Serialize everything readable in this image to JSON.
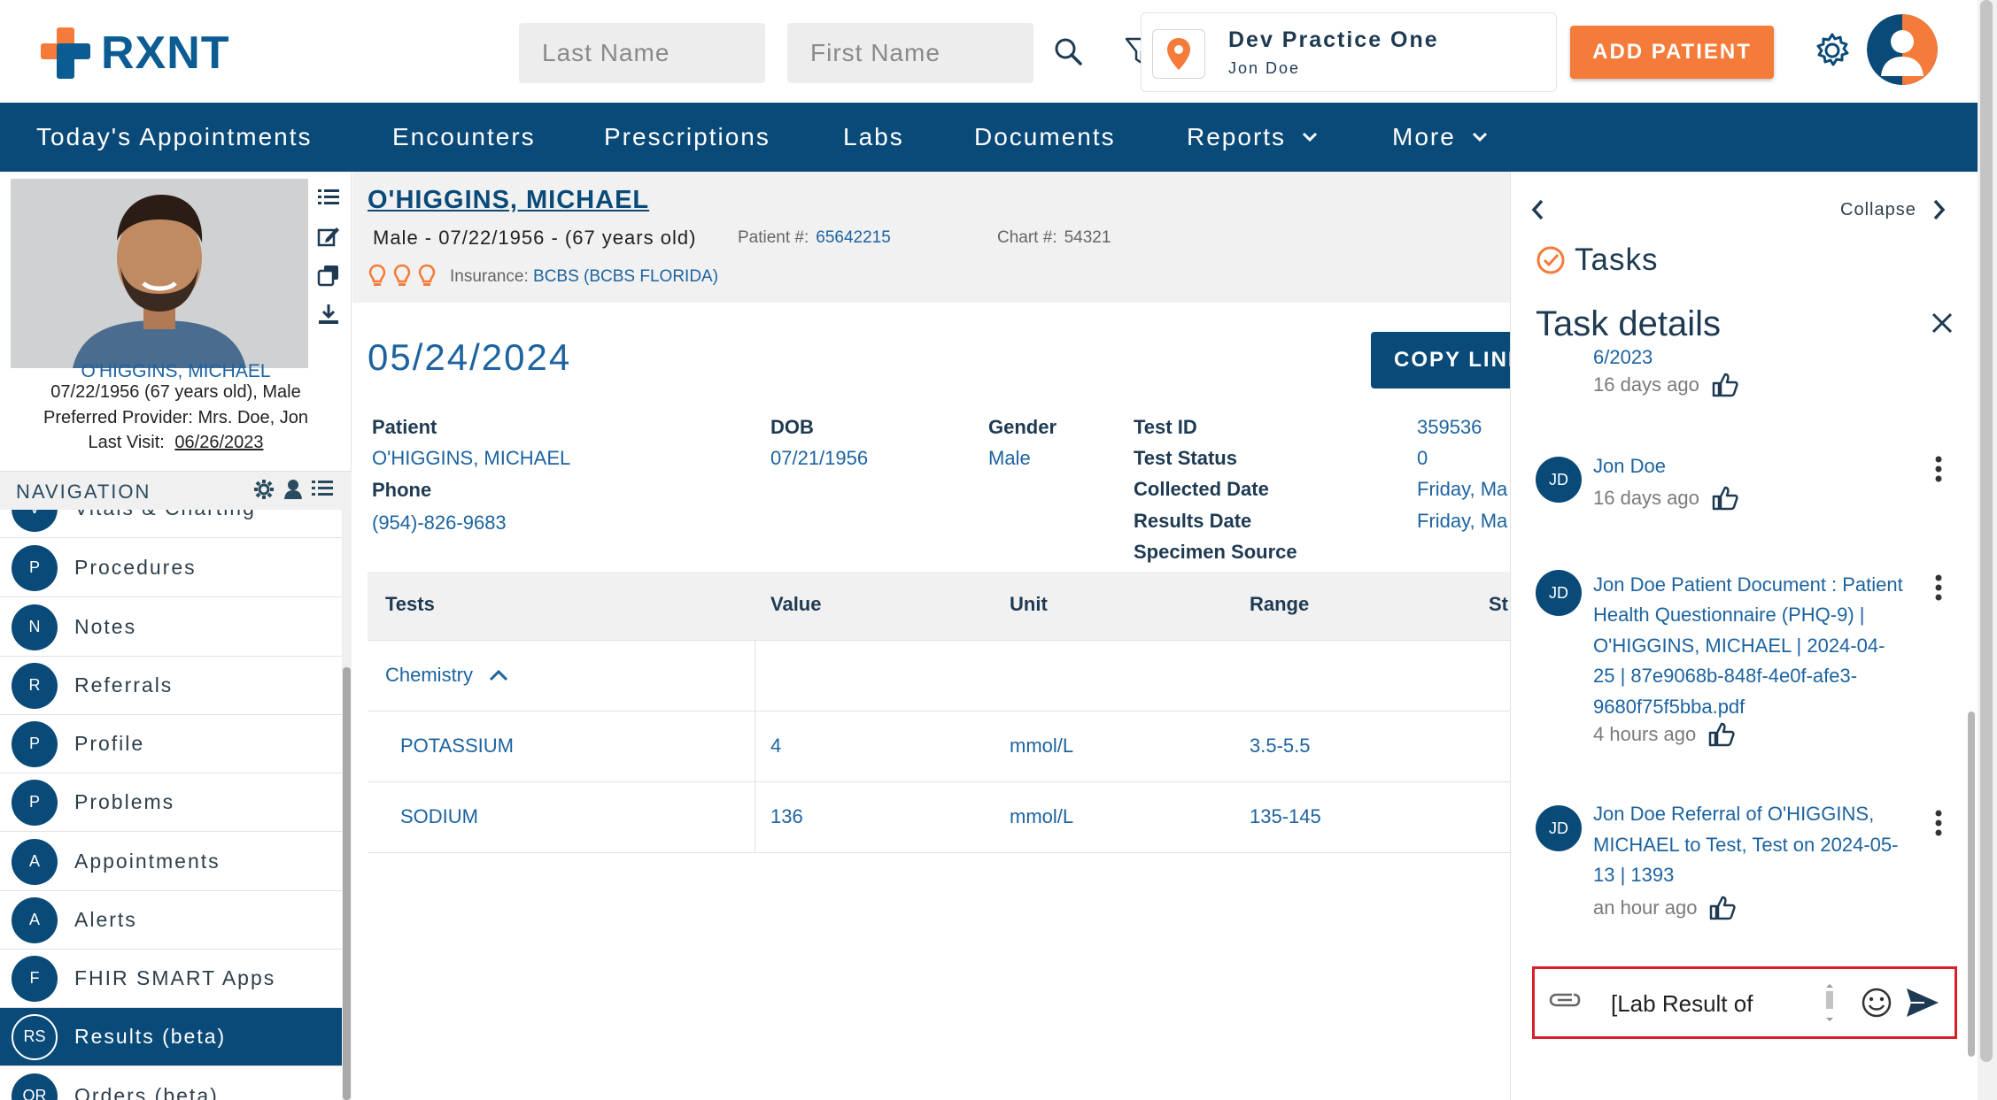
{
  "header": {
    "logo_text": "RXNT",
    "last_name_placeholder": "Last Name",
    "first_name_placeholder": "First Name",
    "practice_name": "Dev Practice One",
    "practice_user": "Jon Doe",
    "add_patient_label": "ADD PATIENT",
    "brand_color": "#0a5c93",
    "accent_color": "#f47b39"
  },
  "nav": {
    "items": [
      {
        "label": "Today's Appointments"
      },
      {
        "label": "Encounters"
      },
      {
        "label": "Prescriptions"
      },
      {
        "label": "Labs"
      },
      {
        "label": "Documents"
      },
      {
        "label": "Reports"
      },
      {
        "label": "More"
      }
    ]
  },
  "patient_card": {
    "name": "O'HIGGINS, MICHAEL",
    "dob_line": "07/22/1956 (67 years old), Male",
    "provider_line": "Preferred Provider: Mrs. Doe, Jon",
    "last_visit_label": "Last Visit:",
    "last_visit": "06/26/2023"
  },
  "navigation": {
    "title": "NAVIGATION",
    "items": [
      {
        "initial": "V",
        "label": "Vitals & Charting"
      },
      {
        "initial": "P",
        "label": "Procedures"
      },
      {
        "initial": "N",
        "label": "Notes"
      },
      {
        "initial": "R",
        "label": "Referrals"
      },
      {
        "initial": "P",
        "label": "Profile"
      },
      {
        "initial": "P",
        "label": "Problems"
      },
      {
        "initial": "A",
        "label": "Appointments"
      },
      {
        "initial": "A",
        "label": "Alerts"
      },
      {
        "initial": "F",
        "label": "FHIR SMART Apps"
      },
      {
        "initial": "RS",
        "label": "Results (beta)"
      },
      {
        "initial": "OR",
        "label": "Orders (beta)"
      }
    ]
  },
  "patient_header": {
    "title": "O'HIGGINS, MICHAEL",
    "subtitle": "Male - 07/22/1956 - (67 years old)",
    "patient_num_label": "Patient #:",
    "patient_num": "65642215",
    "chart_num_label": "Chart #:",
    "chart_num": "54321",
    "insurance_label": "Insurance:",
    "insurance": "BCBS (BCBS FLORIDA)"
  },
  "result": {
    "date": "05/24/2024",
    "copy_link_label": "COPY LINK",
    "patient_label": "Patient",
    "patient_value": "O'HIGGINS, MICHAEL",
    "phone_label": "Phone",
    "phone_value": "(954)-826-9683",
    "dob_label": "DOB",
    "dob_value": "07/21/1956",
    "gender_label": "Gender",
    "gender_value": "Male",
    "test_id_label": "Test ID",
    "test_id_value": "359536",
    "test_status_label": "Test Status",
    "test_status_value": "0",
    "collected_label": "Collected Date",
    "collected_value": "Friday, Ma",
    "results_date_label": "Results Date",
    "results_date_value": "Friday, Ma",
    "specimen_label": "Specimen Source"
  },
  "table": {
    "headers": [
      "Tests",
      "Value",
      "Unit",
      "Range",
      "St"
    ],
    "group": "Chemistry",
    "rows": [
      {
        "test": "POTASSIUM",
        "value": "4",
        "unit": "mmol/L",
        "range": "3.5-5.5"
      },
      {
        "test": "SODIUM",
        "value": "136",
        "unit": "mmol/L",
        "range": "135-145"
      }
    ]
  },
  "tasks": {
    "collapse_label": "Collapse",
    "title": "Tasks",
    "details_title": "Task details",
    "feed": [
      {
        "text": "6/2023",
        "ago": "16 days ago"
      },
      {
        "avatar": "JD",
        "text": "Jon Doe",
        "ago": "16 days ago"
      },
      {
        "avatar": "JD",
        "lines": [
          "Jon Doe Patient Document : Patient",
          "Health Questionnaire (PHQ-9) |",
          "O'HIGGINS, MICHAEL | 2024-04-",
          "25 | 87e9068b-848f-4e0f-afe3-",
          "9680f75f5bba.pdf"
        ],
        "ago": "4 hours ago"
      },
      {
        "avatar": "JD",
        "lines": [
          "Jon Doe Referral of O'HIGGINS,",
          "MICHAEL to Test, Test on 2024-05-",
          "13 | 1393"
        ],
        "ago": "an hour ago"
      }
    ],
    "composer_text": "[Lab Result of"
  }
}
